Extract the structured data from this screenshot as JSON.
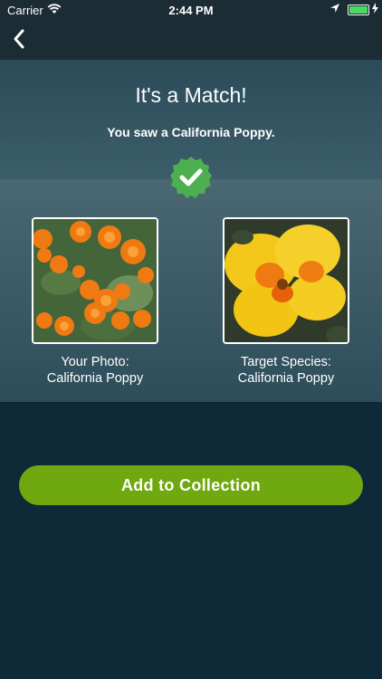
{
  "status_bar": {
    "carrier": "Carrier",
    "time": "2:44 PM"
  },
  "nav": {
    "back_icon": "chevron-left-icon"
  },
  "match": {
    "title": "It's a Match!",
    "subtitle": "You saw a California Poppy.",
    "badge_icon": "checkmark-icon"
  },
  "comparison": {
    "your_photo": {
      "caption_line1": "Your Photo:",
      "caption_line2": "California Poppy"
    },
    "target_species": {
      "caption_line1": "Target Species:",
      "caption_line2": "California Poppy"
    }
  },
  "actions": {
    "add_label": "Add to Collection"
  },
  "colors": {
    "accent": "#6fa80f",
    "badge": "#4caf50",
    "background": "#0e2a38"
  }
}
